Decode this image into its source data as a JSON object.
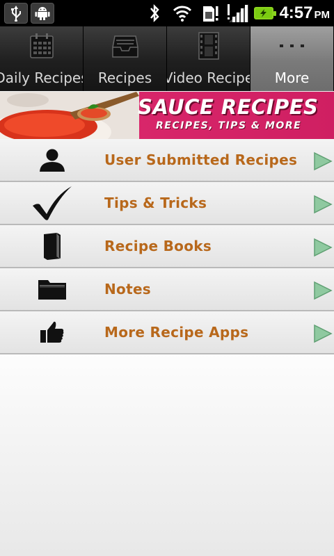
{
  "status_bar": {
    "time": "4:57",
    "ampm": "PM",
    "icons": [
      "usb-icon",
      "android-debug-icon",
      "bluetooth-icon",
      "wifi-icon",
      "sim-alert-icon",
      "signal-icon",
      "battery-charging-icon"
    ]
  },
  "tabs": [
    {
      "label": "Daily Recipes",
      "icon": "calendar-icon",
      "active": false
    },
    {
      "label": "Recipes",
      "icon": "inbox-tray-icon",
      "active": false
    },
    {
      "label": "Video Recipe",
      "icon": "film-strip-icon",
      "active": false
    },
    {
      "label": "More",
      "icon": "more-dots-icon",
      "active": true
    }
  ],
  "banner": {
    "title": "SAUCE RECIPES",
    "subtitle": "RECIPES, TIPS & MORE"
  },
  "menu": {
    "items": [
      {
        "label": "User Submitted Recipes",
        "icon": "user-silhouette-icon"
      },
      {
        "label": "Tips & Tricks",
        "icon": "checkmark-icon"
      },
      {
        "label": "Recipe Books",
        "icon": "book-icon"
      },
      {
        "label": "Notes",
        "icon": "folder-icon"
      },
      {
        "label": "More Recipe Apps",
        "icon": "thumbs-up-icon"
      }
    ]
  },
  "colors": {
    "accent_text": "#b8681b",
    "banner_pink": "#d8266a",
    "arrow_green": "#8fc9a0",
    "active_tab": "#8a8a8a"
  }
}
